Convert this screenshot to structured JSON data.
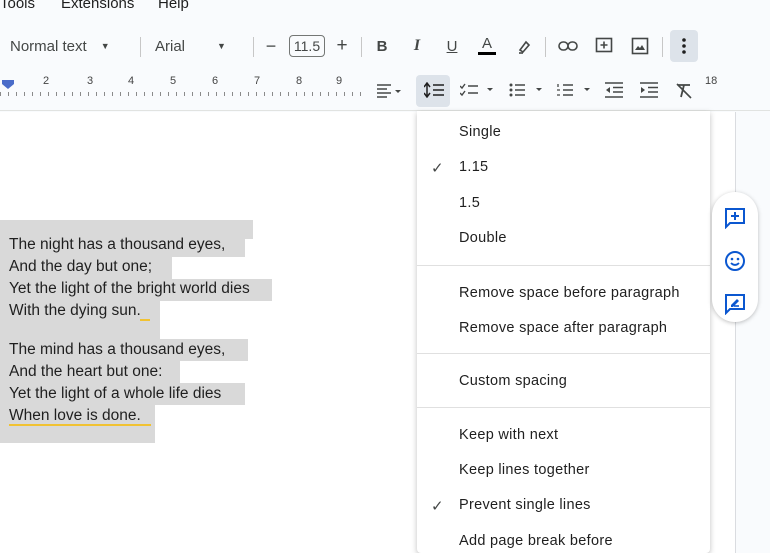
{
  "menubar": {
    "items": [
      "Tools",
      "Extensions",
      "Help"
    ]
  },
  "toolbar": {
    "style_select": "Normal text",
    "font_select": "Arial",
    "decrease": "−",
    "font_size": "11.5",
    "increase": "+",
    "bold": "B",
    "italic": "I",
    "underline": "U",
    "text_color": "A",
    "text_color_value": "#000000"
  },
  "ruler": {
    "numbers": [
      "2",
      "3",
      "4",
      "5",
      "6",
      "7",
      "8",
      "9",
      "18"
    ]
  },
  "document": {
    "stanza1": [
      "The night has a thousand eyes,",
      "And the day but one;",
      "Yet the light of the bright world dies",
      "With the dying sun."
    ],
    "stanza2": [
      "The mind has a thousand eyes,",
      "And the heart but one:",
      "Yet the light of a whole life dies",
      "When love is done."
    ]
  },
  "spacing_menu": {
    "items": [
      {
        "label": "Single",
        "checked": false
      },
      {
        "label": "1.15",
        "checked": true
      },
      {
        "label": "1.5",
        "checked": false
      },
      {
        "label": "Double",
        "checked": false
      },
      {
        "label": "Remove space before paragraph",
        "checked": false
      },
      {
        "label": "Remove space after paragraph",
        "checked": false
      },
      {
        "label": "Custom spacing",
        "checked": false
      },
      {
        "label": "Keep with next",
        "checked": false
      },
      {
        "label": "Keep lines together",
        "checked": false
      },
      {
        "label": "Prevent single lines",
        "checked": true
      },
      {
        "label": "Add page break before",
        "checked": false
      }
    ],
    "check_glyph": "✓"
  },
  "colors": {
    "accent": "#0b57d0",
    "selection": "#d9d9d9",
    "spell_underline": "#f1c232"
  }
}
